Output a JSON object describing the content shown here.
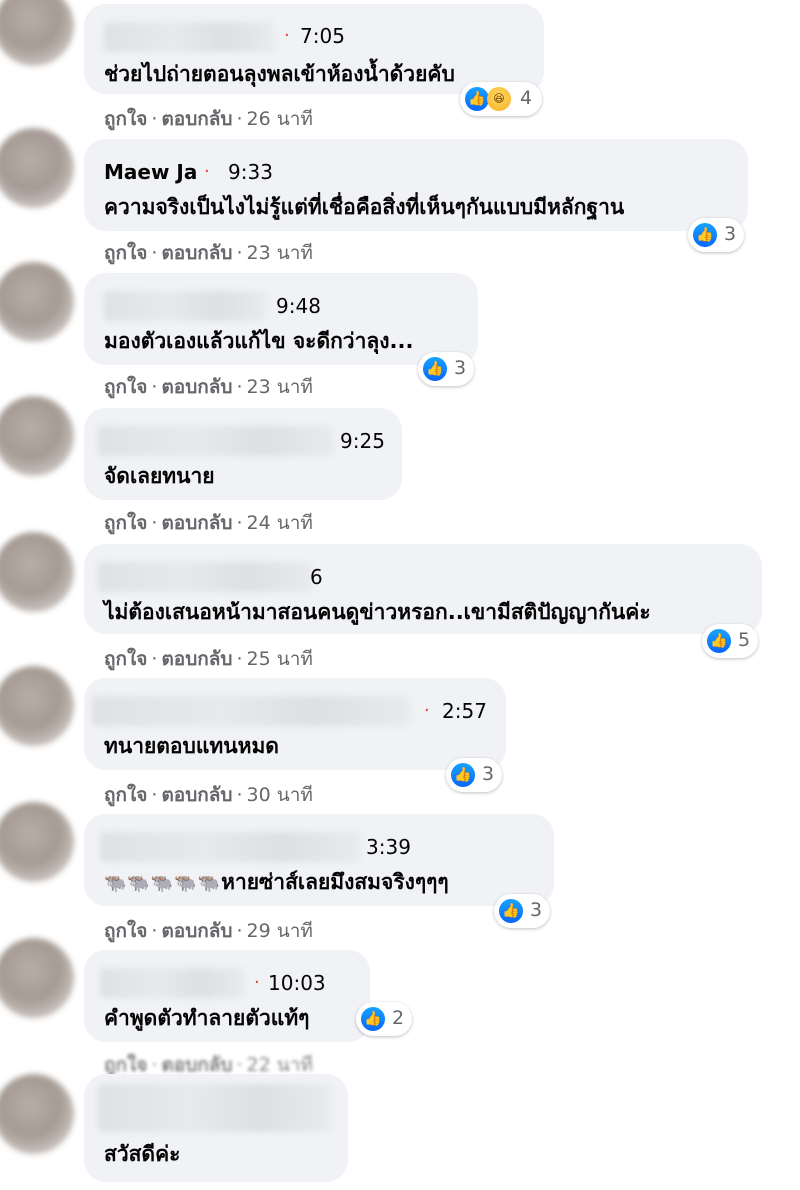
{
  "comments": [
    {
      "name": "",
      "time": "7:05",
      "text": "ช่วยไปถ่ายตอนลุงพลเข้าห้องน้ำด้วยคับ",
      "like": "ถูกใจ",
      "reply": "ตอบกลับ",
      "ago": "26 นาที",
      "reaction_count": "4",
      "reactions": [
        "like-icon",
        "haha-icon"
      ]
    },
    {
      "name": "Maew Ja",
      "time": "9:33",
      "text": "ความจริงเป็นไงไม่รู้แต่ที่เชื่อคือสิ่งที่เห็นๆกันแบบมีหลักฐาน",
      "like": "ถูกใจ",
      "reply": "ตอบกลับ",
      "ago": "23 นาที",
      "reaction_count": "3"
    },
    {
      "name": "",
      "time": "9:48",
      "text": "มองตัวเองแล้วแก้ไข จะดีกว่าลุง...",
      "like": "ถูกใจ",
      "reply": "ตอบกลับ",
      "ago": "23 นาที",
      "reaction_count": "3"
    },
    {
      "name": "",
      "time": "9:25",
      "text": "จัดเลยทนาย",
      "like": "ถูกใจ",
      "reply": "ตอบกลับ",
      "ago": "24 นาที"
    },
    {
      "name": "",
      "time": "6",
      "text": "ไม่ต้องเสนอหน้ามาสอนคนดูข่าวหรอก..เขามีสติปัญญากันค่ะ",
      "like": "ถูกใจ",
      "reply": "ตอบกลับ",
      "ago": "25 นาที",
      "reaction_count": "5"
    },
    {
      "name": "",
      "time": "2:57",
      "text": "ทนายตอบแทนหมด",
      "like": "ถูกใจ",
      "reply": "ตอบกลับ",
      "ago": "30 นาที",
      "reaction_count": "3"
    },
    {
      "name": "",
      "time": "3:39",
      "text": "หายซ่าส์เลยมึงสมจริงๆๆๆ",
      "like": "ถูกใจ",
      "reply": "ตอบกลับ",
      "ago": "29 นาที",
      "reaction_count": "3"
    },
    {
      "name": "",
      "time": "10:03",
      "text": "คำพูดตัวทำลายตัวแท้ๆ",
      "like": "ถูกใจ",
      "reply": "ตอบกลับ",
      "ago": "22 นาที",
      "reaction_count": "2"
    },
    {
      "name": "",
      "time": "",
      "text": "สวัสดีค่ะ"
    }
  ],
  "icons": {
    "like": "thumbs-up-icon",
    "haha": "laughing-face-icon",
    "cow": "cow-emoji-icon"
  },
  "colors": {
    "bubble": "#f0f2f5",
    "like_blue": "#1877f2",
    "action_gray": "#65676b",
    "dot_red": "#e2433b"
  }
}
